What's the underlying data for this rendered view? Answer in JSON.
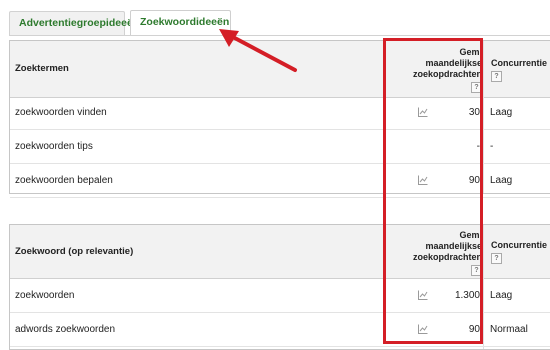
{
  "tabs": [
    {
      "label": "Advertentiegroepideeën",
      "active": false
    },
    {
      "label": "Zoekwoordideeën",
      "active": true
    }
  ],
  "table_terms": {
    "col_keyword": "Zoektermen",
    "col_volume": [
      "Gem.",
      "maandelijkse",
      "zoekopdrachten"
    ],
    "col_competition": "Concurrentie",
    "help_glyph": "?",
    "rows": [
      {
        "keyword": "zoekwoorden vinden",
        "volume": "30",
        "competition": "Laag",
        "has_chart": true
      },
      {
        "keyword": "zoekwoorden tips",
        "volume": "-",
        "competition": "-",
        "has_chart": false
      },
      {
        "keyword": "zoekwoorden bepalen",
        "volume": "90",
        "competition": "Laag",
        "has_chart": true
      }
    ]
  },
  "table_relevance": {
    "col_keyword": "Zoekwoord (op relevantie)",
    "col_volume": [
      "Gem.",
      "maandelijkse",
      "zoekopdrachten"
    ],
    "col_competition": "Concurrentie",
    "help_glyph": "?",
    "rows": [
      {
        "keyword": "zoekwoorden",
        "volume": "1.300",
        "competition": "Laag",
        "has_chart": true
      },
      {
        "keyword": "adwords zoekwoorden",
        "volume": "90",
        "competition": "Normaal",
        "has_chart": true
      }
    ]
  },
  "colors": {
    "highlight": "#d41e26",
    "tab_text": "#2d7a2d",
    "header_bg": "#f2f2f2"
  },
  "icons": {
    "trend": "trend-chart-icon",
    "help": "help-icon",
    "arrow": "pointer-arrow-icon"
  }
}
